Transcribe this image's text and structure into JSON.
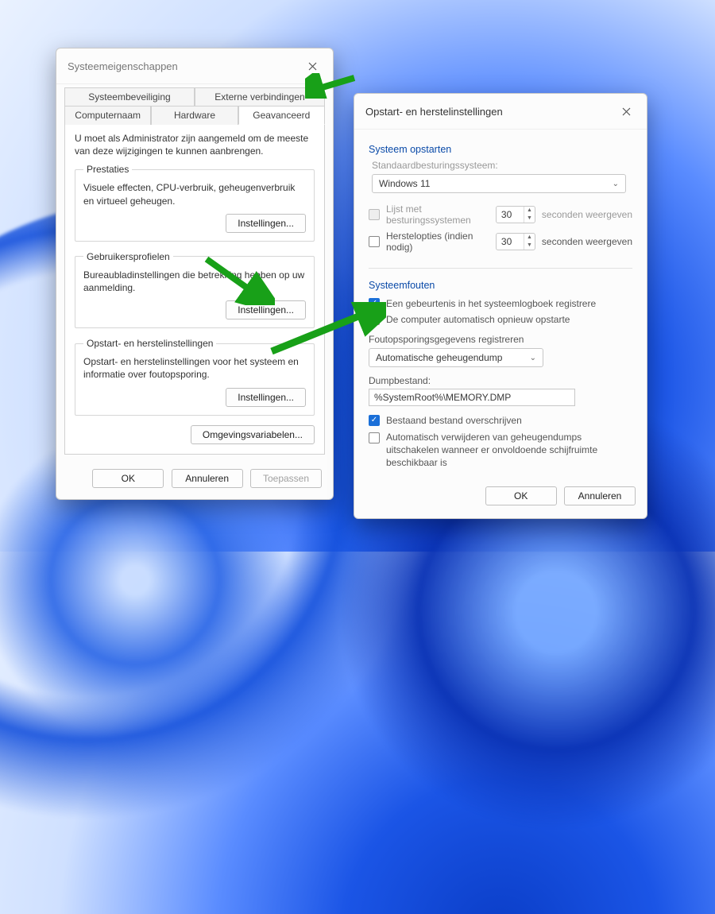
{
  "sysprops": {
    "title": "Systeemeigenschappen",
    "tabs_row1": [
      "Systeembeveiliging",
      "Externe verbindingen"
    ],
    "tabs_row2": [
      "Computernaam",
      "Hardware",
      "Geavanceerd"
    ],
    "admin_note": "U moet als Administrator zijn aangemeld om de meeste van deze wijzigingen te kunnen aanbrengen.",
    "perf": {
      "legend": "Prestaties",
      "desc": "Visuele effecten, CPU-verbruik, geheugenverbruik en virtueel geheugen.",
      "btn": "Instellingen..."
    },
    "profiles": {
      "legend": "Gebruikersprofielen",
      "desc": "Bureaubladinstellingen die betrekking hebben op uw aanmelding.",
      "btn": "Instellingen..."
    },
    "startup": {
      "legend": "Opstart- en herstelinstellingen",
      "desc": "Opstart- en herstelinstellingen voor het systeem en informatie over foutopsporing.",
      "btn": "Instellingen..."
    },
    "envvars_btn": "Omgevingsvariabelen...",
    "ok": "OK",
    "cancel": "Annuleren",
    "apply": "Toepassen"
  },
  "startup_dlg": {
    "title": "Opstart- en herstelinstellingen",
    "sys_start": {
      "heading": "Systeem opstarten",
      "default_os_label": "Standaardbesturingssysteem:",
      "default_os_value": "Windows 11",
      "show_os_list_label": "Lijst met besturingssystemen",
      "show_os_list_seconds": "30",
      "seconds_text": "seconden weergeven",
      "recovery_label": "Herstelopties (indien nodig)",
      "recovery_seconds": "30"
    },
    "sys_fail": {
      "heading": "Systeemfouten",
      "log_event": "Een gebeurtenis in het systeemlogboek registrere",
      "auto_restart": "De computer automatisch opnieuw opstarte",
      "debug_heading": "Foutopsporingsgegevens registreren",
      "dump_type": "Automatische geheugendump",
      "dump_file_label": "Dumpbestand:",
      "dump_file_value": "%SystemRoot%\\MEMORY.DMP",
      "overwrite": "Bestaand bestand overschrijven",
      "disable_autodelete": "Automatisch verwijderen van geheugendumps uitschakelen wanneer er onvoldoende schijfruimte beschikbaar is"
    },
    "ok": "OK",
    "cancel": "Annuleren"
  }
}
